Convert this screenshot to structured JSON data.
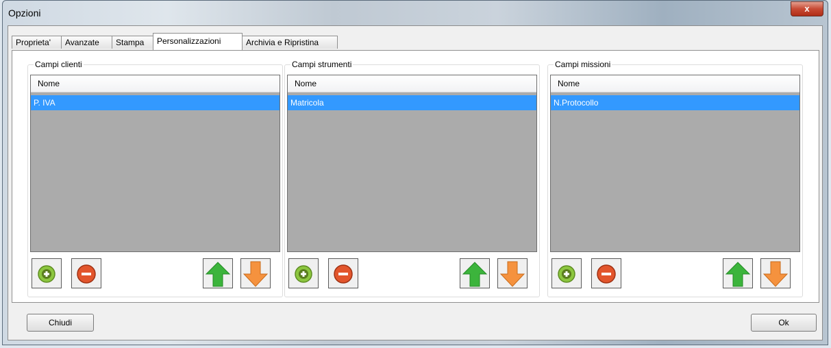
{
  "window": {
    "title": "Opzioni",
    "close_label": "x"
  },
  "tabs": [
    {
      "label": "Proprieta'"
    },
    {
      "label": "Avanzate"
    },
    {
      "label": "Stampa"
    },
    {
      "label": "Personalizzazioni",
      "active": true
    },
    {
      "label": "Archivia e Ripristina"
    }
  ],
  "groups": [
    {
      "label": "Campi clienti",
      "column_header": "Nome",
      "rows": [
        "P. IVA"
      ]
    },
    {
      "label": "Campi strumenti",
      "column_header": "Nome",
      "rows": [
        "Matricola"
      ]
    },
    {
      "label": "Campi missioni",
      "column_header": "Nome",
      "rows": [
        "N.Protocollo"
      ]
    }
  ],
  "icons": {
    "add": "plus-icon",
    "remove": "minus-icon",
    "up": "arrow-up-icon",
    "down": "arrow-down-icon"
  },
  "footer": {
    "close_label": "Chiudi",
    "ok_label": "Ok"
  },
  "colors": {
    "selection": "#3399ff",
    "list_bg": "#ababab",
    "add": "#8cc63f",
    "remove": "#e2552c",
    "up": "#3cb43c",
    "down": "#f5923e"
  }
}
